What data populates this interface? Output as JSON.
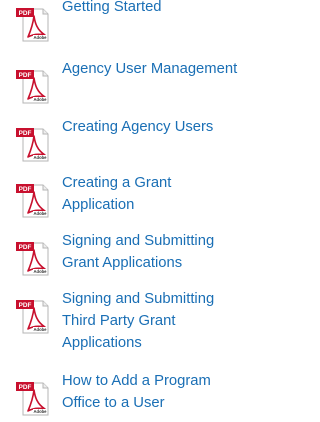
{
  "documents": [
    {
      "icon": "pdf-file-icon",
      "title": "Getting Started"
    },
    {
      "icon": "pdf-file-icon",
      "title": "Agency User Management"
    },
    {
      "icon": "pdf-file-icon",
      "title": "Creating Agency Users"
    },
    {
      "icon": "pdf-file-icon",
      "title": "Creating a Grant Application"
    },
    {
      "icon": "pdf-file-icon",
      "title": "Signing and Submitting Grant Applications"
    },
    {
      "icon": "pdf-file-icon",
      "title": "Signing and Submitting Third Party Grant Applications"
    },
    {
      "icon": "pdf-file-icon",
      "title": "How to Add a Program Office to a User"
    }
  ],
  "icon_label": "PDF",
  "icon_brand": "Adobe",
  "colors": {
    "link": "#1a6fb5",
    "pdf_badge": "#c8102e",
    "adobe_swoosh": "#c8102e"
  }
}
